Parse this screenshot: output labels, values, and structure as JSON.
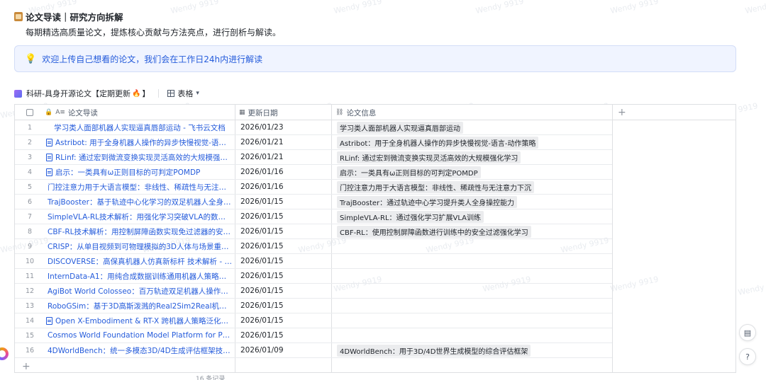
{
  "heading": "论文导读｜研究方向拆解",
  "subtitle": "每期精选高质量论文，提炼核心贡献与方法亮点，进行剖析与解读。",
  "callout": "欢迎上传自己想看的论文，我们会在工作日24h内进行解读",
  "view": {
    "name": "科研-具身开源论文【定期更新",
    "name_suffix": "】",
    "view_type": "表格"
  },
  "columns": {
    "title": "论文导读",
    "date": "更新日期",
    "info": "论文信息"
  },
  "rows": [
    {
      "idx": "1",
      "title": "学习类人面部机器人实现逼真唇部运动 - 飞书云文档",
      "doc": false,
      "date": "2026/01/23",
      "info": "学习类人面部机器人实现逼真唇部运动"
    },
    {
      "idx": "2",
      "title": "Astribot: 用于全身机器人操作的异步快慢视觉-语言-动作策...",
      "doc": true,
      "date": "2026/01/21",
      "info": "Astribot：用于全身机器人操作的异步快慢视觉-语言-动作策略"
    },
    {
      "idx": "3",
      "title": "RLinf: 通过宏到微流变换实现灵活高效的大规模强化学习",
      "doc": true,
      "date": "2026/01/21",
      "info": "RLinf: 通过宏到微流变换实现灵活高效的大规模强化学习"
    },
    {
      "idx": "4",
      "title": "启示：一类具有ω正则目标的可判定POMDP",
      "doc": true,
      "date": "2026/01/16",
      "info": "启示：一类具有ω正则目标的可判定POMDP"
    },
    {
      "idx": "5",
      "title": "门控注意力用于大语言模型：非线性、稀疏性与无注意力下沉...",
      "doc": false,
      "date": "2026/01/16",
      "info": "门控注意力用于大语言模型：非线性、稀疏性与无注意力下沉"
    },
    {
      "idx": "6",
      "title": "TrajBooster：基于轨迹中心化学习的双足机器人全身操作...",
      "doc": false,
      "date": "2026/01/15",
      "info": "TrajBooster：通过轨迹中心学习提升类人全身操控能力"
    },
    {
      "idx": "7",
      "title": "SimpleVLA-RL技术解析：用强化学习突破VLA的数据瓶颈 - 飞...",
      "doc": false,
      "date": "2026/01/15",
      "info": "SimpleVLA-RL：通过强化学习扩展VLA训练"
    },
    {
      "idx": "8",
      "title": "CBF-RL技术解析：用控制屏障函数实现免过滤器的安全策略...",
      "doc": false,
      "date": "2026/01/15",
      "info": "CBF-RL：使用控制屏障函数进行训练中的安全过滤强化学习"
    },
    {
      "idx": "9",
      "title": "CRISP：从单目视频到可物理模拟的3D人体与场景重建技术解...",
      "doc": false,
      "date": "2026/01/15",
      "info": ""
    },
    {
      "idx": "10",
      "title": "DISCOVERSE：高保真机器人仿真新标杆 技术解析 - 飞书云...",
      "doc": false,
      "date": "2026/01/15",
      "info": ""
    },
    {
      "idx": "11",
      "title": "InternData-A1：用纯合成数据训练通用机器人策略的技术...",
      "doc": false,
      "date": "2026/01/15",
      "info": ""
    },
    {
      "idx": "12",
      "title": "AgiBot World Colosseo：百万轨迹双足机器人操作平台技术...",
      "doc": false,
      "date": "2026/01/15",
      "info": ""
    },
    {
      "idx": "13",
      "title": "RoboGSim：基于3D高斯泼溅的Real2Sim2Real机器人仿真...",
      "doc": false,
      "date": "2026/01/15",
      "info": ""
    },
    {
      "idx": "14",
      "title": "Open X-Embodiment & RT-X 跨机器人策略泛化技术解析",
      "doc": true,
      "date": "2026/01/15",
      "info": ""
    },
    {
      "idx": "15",
      "title": "Cosmos World Foundation Model Platform for Physical AI -...",
      "doc": false,
      "date": "2026/01/15",
      "info": ""
    },
    {
      "idx": "16",
      "title": "4DWorldBench：统一多模态3D/4D生成评估框架技术解析 - ...",
      "doc": false,
      "date": "2026/01/09",
      "info": "4DWorldBench：用于3D/4D世界生成模型的综合评估框架"
    }
  ],
  "add_row_label": "+",
  "add_column_label": "+",
  "footer_count": "16 条记录",
  "watermark": "Wendy 9919",
  "icons": {
    "heading": "scroll-icon",
    "callout": "lightbulb-icon",
    "view": "bitable-icon",
    "fire": "fire-icon",
    "view_type": "table-grid-icon",
    "side_top": "template-icon",
    "side_bottom": "help-icon"
  },
  "colors": {
    "link": "#245bdb",
    "callout_bg": "#f0f4ff",
    "tag_bg": "#ebecee"
  }
}
